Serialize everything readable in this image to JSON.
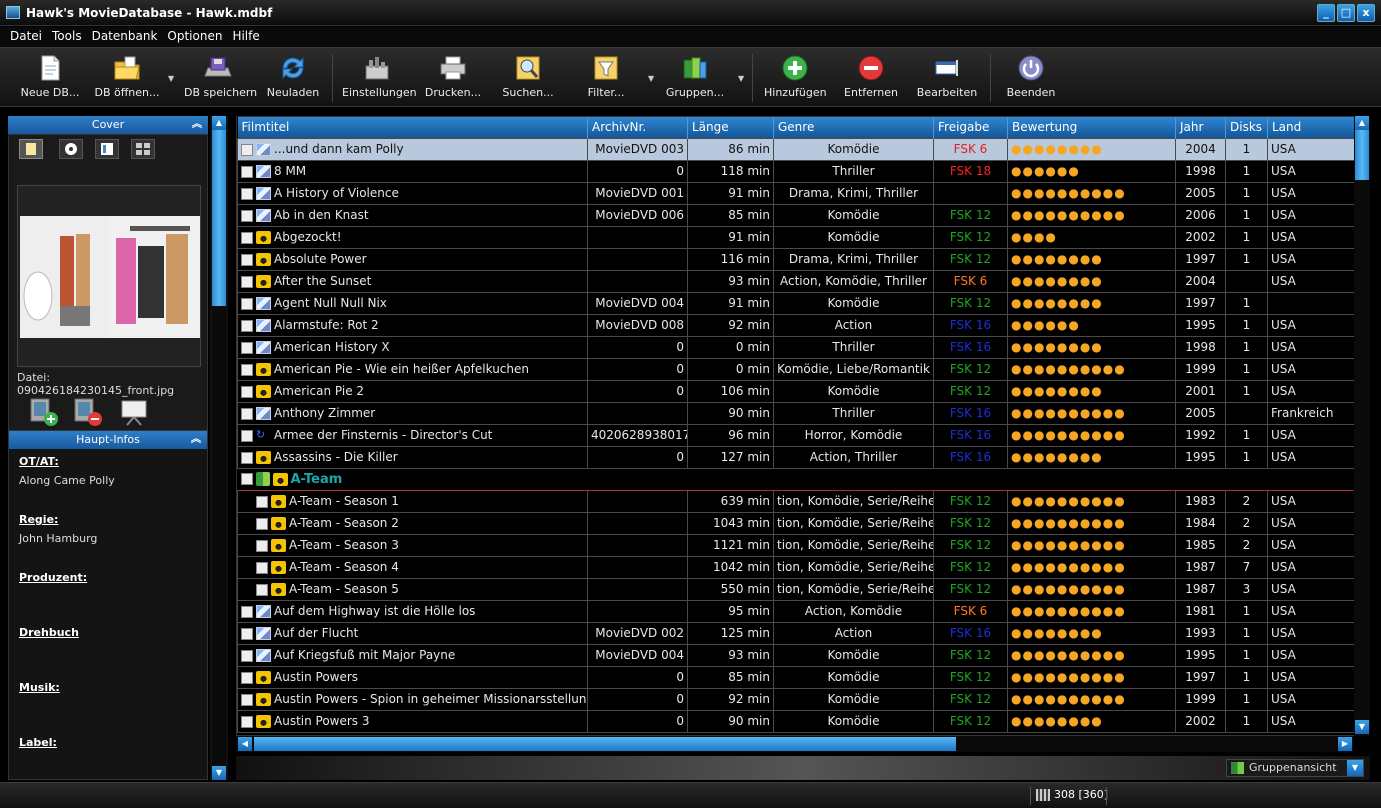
{
  "window": {
    "title": "Hawk's MovieDatabase - Hawk.mdbf",
    "minimize": "_",
    "maximize": "□",
    "close": "x"
  },
  "menu": [
    "Datei",
    "Tools",
    "Datenbank",
    "Optionen",
    "Hilfe"
  ],
  "toolbar": {
    "new_db": "Neue DB...",
    "open_db": "DB öffnen...",
    "save_db": "DB speichern",
    "reload": "Neuladen",
    "settings": "Einstellungen",
    "print": "Drucken...",
    "search": "Suchen...",
    "filter": "Filter...",
    "groups": "Gruppen...",
    "add": "Hinzufügen",
    "remove": "Entfernen",
    "edit": "Bearbeiten",
    "quit": "Beenden"
  },
  "left_panel": {
    "cover_header": "Cover",
    "cover_file": "Datei: 090426184230145_front.jpg",
    "main_info_header": "Haupt-Infos",
    "fields": [
      {
        "label": "OT/AT:",
        "value": "Along Came Polly"
      },
      {
        "label": "Regie:",
        "value": "John Hamburg"
      },
      {
        "label": "Produzent:",
        "value": ""
      },
      {
        "label": "Drehbuch",
        "value": ""
      },
      {
        "label": "Musik:",
        "value": ""
      },
      {
        "label": "Label:",
        "value": ""
      }
    ]
  },
  "grid": {
    "columns": [
      "Filmtitel",
      "ArchivNr.",
      "Länge",
      "Genre",
      "Freigabe",
      "Bewertung",
      "Jahr",
      "Disks",
      "Land"
    ],
    "rows": [
      {
        "type": "dvd",
        "title": "...und dann kam Polly",
        "archiv": "MovieDVD 003",
        "len": "86 min",
        "genre": "Komödie",
        "fsk": "FSK 6",
        "fskc": "fsk6",
        "stars": 8,
        "year": "2004",
        "disks": "1",
        "land": "USA",
        "sel": true
      },
      {
        "type": "dvd",
        "title": "8 MM",
        "archiv": "0",
        "len": "118 min",
        "genre": "Thriller",
        "fsk": "FSK 18",
        "fskc": "fsk18",
        "stars": 6,
        "year": "1998",
        "disks": "1",
        "land": "USA"
      },
      {
        "type": "dvd",
        "title": "A History of Violence",
        "archiv": "MovieDVD 001",
        "len": "91 min",
        "genre": "Drama, Krimi, Thriller",
        "fsk": "",
        "fskc": "",
        "stars": 10,
        "year": "2005",
        "disks": "1",
        "land": "USA"
      },
      {
        "type": "dvd",
        "title": "Ab in den Knast",
        "archiv": "MovieDVD 006",
        "len": "85 min",
        "genre": "Komödie",
        "fsk": "FSK 12",
        "fskc": "fsk12",
        "stars": 10,
        "year": "2006",
        "disks": "1",
        "land": "USA"
      },
      {
        "type": "vhs",
        "title": "Abgezockt!",
        "archiv": "",
        "len": "91 min",
        "genre": "Komödie",
        "fsk": "FSK 12",
        "fskc": "fsk12",
        "stars": 4,
        "year": "2002",
        "disks": "1",
        "land": "USA"
      },
      {
        "type": "vhs",
        "title": "Absolute Power",
        "archiv": "",
        "len": "116 min",
        "genre": "Drama, Krimi, Thriller",
        "fsk": "FSK 12",
        "fskc": "fsk12",
        "stars": 8,
        "year": "1997",
        "disks": "1",
        "land": "USA"
      },
      {
        "type": "vhs",
        "title": "After the Sunset",
        "archiv": "",
        "len": "93 min",
        "genre": "Action, Komödie, Thriller",
        "fsk": "FSK 6",
        "fskc": "fsk6",
        "stars": 8,
        "year": "2004",
        "disks": "",
        "land": "USA"
      },
      {
        "type": "dvd",
        "title": "Agent Null Null Nix",
        "archiv": "MovieDVD 004",
        "len": "91 min",
        "genre": "Komödie",
        "fsk": "FSK 12",
        "fskc": "fsk12",
        "stars": 8,
        "year": "1997",
        "disks": "1",
        "land": ""
      },
      {
        "type": "dvd",
        "title": "Alarmstufe: Rot 2",
        "archiv": "MovieDVD 008",
        "len": "92 min",
        "genre": "Action",
        "fsk": "FSK 16",
        "fskc": "fsk16",
        "stars": 6,
        "year": "1995",
        "disks": "1",
        "land": "USA"
      },
      {
        "type": "dvd",
        "title": "American History X",
        "archiv": "0",
        "len": "0 min",
        "genre": "Thriller",
        "fsk": "FSK 16",
        "fskc": "fsk16",
        "stars": 8,
        "year": "1998",
        "disks": "1",
        "land": "USA"
      },
      {
        "type": "vhs",
        "title": "American Pie - Wie ein heißer Apfelkuchen",
        "archiv": "0",
        "len": "0 min",
        "genre": "Komödie, Liebe/Romantik",
        "fsk": "FSK 12",
        "fskc": "fsk12",
        "stars": 10,
        "year": "1999",
        "disks": "1",
        "land": "USA"
      },
      {
        "type": "vhs",
        "title": "American Pie 2",
        "archiv": "0",
        "len": "106 min",
        "genre": "Komödie",
        "fsk": "FSK 12",
        "fskc": "fsk12",
        "stars": 8,
        "year": "2001",
        "disks": "1",
        "land": "USA"
      },
      {
        "type": "dvd",
        "title": "Anthony Zimmer",
        "archiv": "",
        "len": "90 min",
        "genre": "Thriller",
        "fsk": "FSK 16",
        "fskc": "fsk16",
        "stars": 10,
        "year": "2005",
        "disks": "",
        "land": "Frankreich"
      },
      {
        "type": "dc",
        "title": "Armee der Finsternis - Director's Cut",
        "archiv": "4020628938017",
        "len": "96 min",
        "genre": "Horror, Komödie",
        "fsk": "FSK 16",
        "fskc": "fsk16",
        "stars": 10,
        "year": "1992",
        "disks": "1",
        "land": "USA"
      },
      {
        "type": "vhs",
        "title": "Assassins - Die Killer",
        "archiv": "0",
        "len": "127 min",
        "genre": "Action, Thriller",
        "fsk": "FSK 16",
        "fskc": "fsk16",
        "stars": 8,
        "year": "1995",
        "disks": "1",
        "land": "USA"
      },
      {
        "type": "group",
        "title": "A-Team"
      },
      {
        "type": "vhs",
        "indent": true,
        "title": "A-Team - Season 1",
        "archiv": "",
        "len": "639 min",
        "genre": "tion, Komödie, Serie/Reihe/(",
        "fsk": "FSK 12",
        "fskc": "fsk12",
        "stars": 10,
        "year": "1983",
        "disks": "2",
        "land": "USA"
      },
      {
        "type": "vhs",
        "indent": true,
        "title": "A-Team - Season 2",
        "archiv": "",
        "len": "1043 min",
        "genre": "tion, Komödie, Serie/Reihe/(",
        "fsk": "FSK 12",
        "fskc": "fsk12",
        "stars": 10,
        "year": "1984",
        "disks": "2",
        "land": "USA"
      },
      {
        "type": "vhs",
        "indent": true,
        "title": "A-Team - Season 3",
        "archiv": "",
        "len": "1121 min",
        "genre": "tion, Komödie, Serie/Reihe/(",
        "fsk": "FSK 12",
        "fskc": "fsk12",
        "stars": 10,
        "year": "1985",
        "disks": "2",
        "land": "USA"
      },
      {
        "type": "vhs",
        "indent": true,
        "title": "A-Team - Season 4",
        "archiv": "",
        "len": "1042 min",
        "genre": "tion, Komödie, Serie/Reihe/(",
        "fsk": "FSK 12",
        "fskc": "fsk12",
        "stars": 10,
        "year": "1987",
        "disks": "7",
        "land": "USA"
      },
      {
        "type": "vhs",
        "indent": true,
        "title": "A-Team - Season 5",
        "archiv": "",
        "len": "550 min",
        "genre": "tion, Komödie, Serie/Reihe/(",
        "fsk": "FSK 12",
        "fskc": "fsk12",
        "stars": 10,
        "year": "1987",
        "disks": "3",
        "land": "USA"
      },
      {
        "type": "dvd",
        "title": "Auf dem Highway ist die Hölle los",
        "archiv": "",
        "len": "95 min",
        "genre": "Action, Komödie",
        "fsk": "FSK 6",
        "fskc": "fsk6",
        "stars": 10,
        "year": "1981",
        "disks": "1",
        "land": "USA"
      },
      {
        "type": "dvd",
        "title": "Auf der Flucht",
        "archiv": "MovieDVD 002",
        "len": "125 min",
        "genre": "Action",
        "fsk": "FSK 16",
        "fskc": "fsk16",
        "stars": 8,
        "year": "1993",
        "disks": "1",
        "land": "USA"
      },
      {
        "type": "dvd",
        "title": "Auf Kriegsfuß mit Major Payne",
        "archiv": "MovieDVD 004",
        "len": "93 min",
        "genre": "Komödie",
        "fsk": "FSK 12",
        "fskc": "fsk12",
        "stars": 10,
        "year": "1995",
        "disks": "1",
        "land": "USA"
      },
      {
        "type": "vhs",
        "title": "Austin Powers",
        "archiv": "0",
        "len": "85 min",
        "genre": "Komödie",
        "fsk": "FSK 12",
        "fskc": "fsk12",
        "stars": 10,
        "year": "1997",
        "disks": "1",
        "land": "USA"
      },
      {
        "type": "vhs",
        "title": "Austin Powers - Spion in geheimer Missionarsstellung",
        "archiv": "0",
        "len": "92 min",
        "genre": "Komödie",
        "fsk": "FSK 12",
        "fskc": "fsk12",
        "stars": 10,
        "year": "1999",
        "disks": "1",
        "land": "USA"
      },
      {
        "type": "vhs",
        "title": "Austin Powers 3",
        "archiv": "0",
        "len": "90 min",
        "genre": "Komödie",
        "fsk": "FSK 12",
        "fskc": "fsk12",
        "stars": 8,
        "year": "2002",
        "disks": "1",
        "land": "USA"
      }
    ]
  },
  "bottom": {
    "view": "Gruppenansicht"
  },
  "status": {
    "count": "308 [360]"
  },
  "colors": {
    "accent": "#1e88d8",
    "selection": "#b9c9dd",
    "fsk6": "#ff7a20",
    "fsk12": "#1fa61f",
    "fsk16": "#1e2dd6",
    "fsk18": "#ff2020",
    "group_title": "#1aa6a6"
  }
}
